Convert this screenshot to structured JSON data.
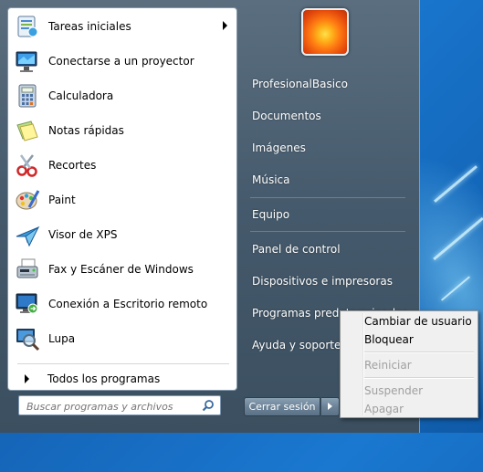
{
  "programs": [
    {
      "label": "Tareas iniciales",
      "icon": "getting-started-icon",
      "has_submenu": true
    },
    {
      "label": "Conectarse a un proyector",
      "icon": "projector-icon",
      "has_submenu": false
    },
    {
      "label": "Calculadora",
      "icon": "calculator-icon",
      "has_submenu": false
    },
    {
      "label": "Notas rápidas",
      "icon": "sticky-notes-icon",
      "has_submenu": false
    },
    {
      "label": "Recortes",
      "icon": "scissors-icon",
      "has_submenu": false
    },
    {
      "label": "Paint",
      "icon": "paint-palette-icon",
      "has_submenu": false
    },
    {
      "label": "Visor de XPS",
      "icon": "xps-viewer-icon",
      "has_submenu": false
    },
    {
      "label": "Fax y Escáner de Windows",
      "icon": "fax-scanner-icon",
      "has_submenu": false
    },
    {
      "label": "Conexión a Escritorio remoto",
      "icon": "remote-desktop-icon",
      "has_submenu": false
    },
    {
      "label": "Lupa",
      "icon": "magnifier-icon",
      "has_submenu": false
    }
  ],
  "all_programs": "Todos los programas",
  "search": {
    "placeholder": "Buscar programas y archivos"
  },
  "user_picture_icon": "orange-flower-avatar",
  "right_items": [
    {
      "label": "ProfesionalBasico"
    },
    {
      "label": "Documentos"
    },
    {
      "label": "Imágenes"
    },
    {
      "label": "Música"
    },
    {
      "label": "Equipo"
    },
    {
      "label": "Panel de control"
    },
    {
      "label": "Dispositivos e impresoras"
    },
    {
      "label": "Programas predeterminados"
    },
    {
      "label": "Ayuda y soporte técnico"
    }
  ],
  "shutdown_label": "Cerrar sesión",
  "context_menu": [
    {
      "label": "Cambiar de usuario",
      "enabled": true
    },
    {
      "label": "Bloquear",
      "enabled": true
    },
    {
      "label": "Reiniciar",
      "enabled": false
    },
    {
      "label": "Suspender",
      "enabled": false
    },
    {
      "label": "Apagar",
      "enabled": false
    }
  ],
  "colors": {
    "menu_frame": "#44596b",
    "desktop": "#1a78d0",
    "disabled_text": "#a0a0a0"
  }
}
